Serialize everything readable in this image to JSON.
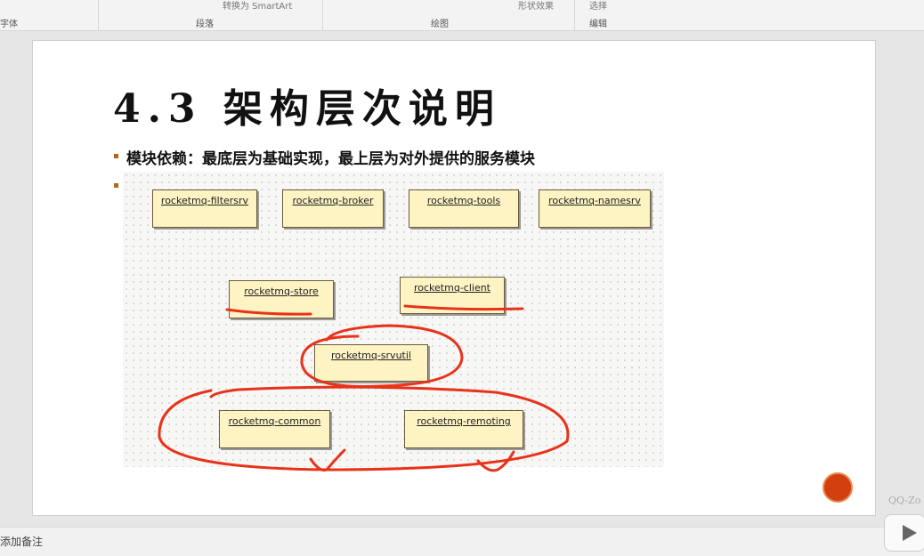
{
  "ribbon": {
    "groups": [
      "字体",
      "段落",
      "绘图",
      "编辑"
    ],
    "smartart": "转换为 SmartArt",
    "shape_effects": "形状效果",
    "select": "选择"
  },
  "slide": {
    "title": "4.3 架构层次说明",
    "bullet1": "模块依赖：最底层为基础实现，最上层为对外提供的服务模块",
    "modules": [
      "rocketmq-filtersrv",
      "rocketmq-broker",
      "rocketmq-tools",
      "rocketmq-namesrv",
      "rocketmq-store",
      "rocketmq-client",
      "rocketmq-srvutil",
      "rocketmq-common",
      "rocketmq-remoting"
    ]
  },
  "notes": {
    "placeholder": "添加备注"
  },
  "watermark": "QQ-Zo",
  "colors": {
    "annotation": "#e8321a",
    "box_fill": "#fdf3c3",
    "record_button": "#d2400f"
  }
}
